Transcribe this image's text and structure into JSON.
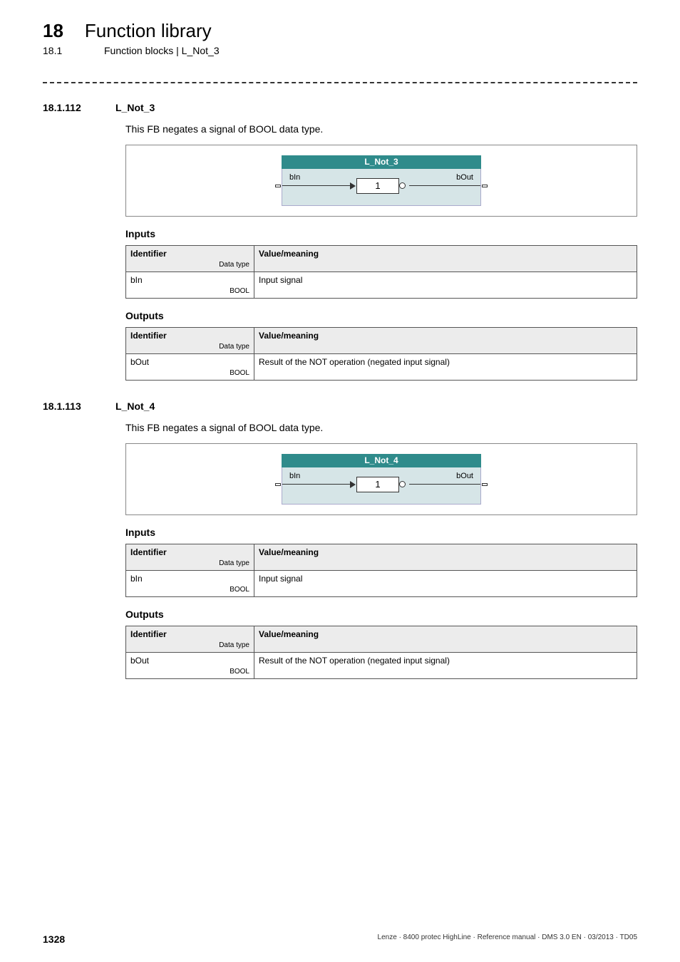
{
  "header": {
    "chapter_num": "18",
    "chapter_title": "Function library",
    "sub_num": "18.1",
    "breadcrumb": "Function blocks | L_Not_3"
  },
  "sections": [
    {
      "num": "18.1.112",
      "title": "L_Not_3",
      "description": "This FB negates a signal of BOOL data type.",
      "fb": {
        "name": "L_Not_3",
        "in_label": "bIn",
        "out_label": "bOut",
        "gate": "1"
      },
      "inputs_heading": "Inputs",
      "inputs_header_id": "Identifier",
      "inputs_header_dt": "Data type",
      "inputs_header_val": "Value/meaning",
      "inputs": [
        {
          "name": "bIn",
          "dtype": "BOOL",
          "meaning": "Input signal"
        }
      ],
      "outputs_heading": "Outputs",
      "outputs_header_id": "Identifier",
      "outputs_header_dt": "Data type",
      "outputs_header_val": "Value/meaning",
      "outputs": [
        {
          "name": "bOut",
          "dtype": "BOOL",
          "meaning": "Result of the NOT operation (negated input signal)"
        }
      ]
    },
    {
      "num": "18.1.113",
      "title": "L_Not_4",
      "description": "This FB negates a signal of BOOL data type.",
      "fb": {
        "name": "L_Not_4",
        "in_label": "bIn",
        "out_label": "bOut",
        "gate": "1"
      },
      "inputs_heading": "Inputs",
      "inputs_header_id": "Identifier",
      "inputs_header_dt": "Data type",
      "inputs_header_val": "Value/meaning",
      "inputs": [
        {
          "name": "bIn",
          "dtype": "BOOL",
          "meaning": "Input signal"
        }
      ],
      "outputs_heading": "Outputs",
      "outputs_header_id": "Identifier",
      "outputs_header_dt": "Data type",
      "outputs_header_val": "Value/meaning",
      "outputs": [
        {
          "name": "bOut",
          "dtype": "BOOL",
          "meaning": "Result of the NOT operation (negated input signal)"
        }
      ]
    }
  ],
  "footer": {
    "page": "1328",
    "text": "Lenze · 8400 protec HighLine · Reference manual · DMS 3.0 EN · 03/2013 · TD05"
  }
}
